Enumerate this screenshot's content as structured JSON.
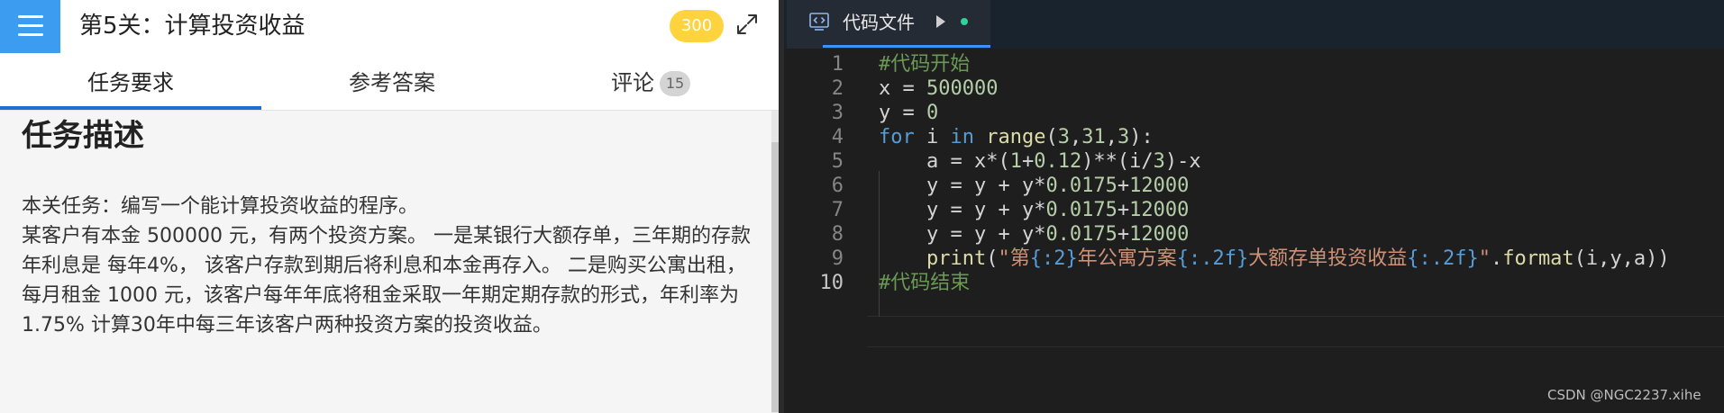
{
  "header": {
    "title": "第5关：计算投资收益",
    "score": "300"
  },
  "tabs": [
    {
      "label": "任务要求"
    },
    {
      "label": "参考答案"
    },
    {
      "label": "评论",
      "badge": "15"
    }
  ],
  "task": {
    "heading": "任务描述",
    "paragraphs": [
      "本关任务：编写一个能计算投资收益的程序。",
      "某客户有本金 500000 元，有两个投资方案。 一是某银行大额存单，三年期的存款年利息是 每年4%， 该客户存款到期后将利息和本金再存入。 二是购买公寓出租，每月租金 1000 元，该客户每年年底将租金采取一年期定期存款的形式，年利率为 1.75% 计算30年中每三年该客户两种投资方案的投资收益。"
    ]
  },
  "editor": {
    "tab_label": "代码文件",
    "lines": [
      {
        "n": "1",
        "indent": "",
        "tokens": [
          [
            "cm",
            "#代码开始"
          ]
        ]
      },
      {
        "n": "2",
        "indent": "",
        "tokens": [
          [
            "id",
            "x = "
          ],
          [
            "num",
            "500000"
          ]
        ]
      },
      {
        "n": "3",
        "indent": "",
        "tokens": [
          [
            "id",
            "y = "
          ],
          [
            "num",
            "0"
          ]
        ]
      },
      {
        "n": "4",
        "indent": "",
        "tokens": [
          [
            "kw",
            "for"
          ],
          [
            "id",
            " i "
          ],
          [
            "kw",
            "in"
          ],
          [
            "id",
            " "
          ],
          [
            "fn",
            "range"
          ],
          [
            "id",
            "("
          ],
          [
            "num",
            "3"
          ],
          [
            "id",
            ","
          ],
          [
            "num",
            "31"
          ],
          [
            "id",
            ","
          ],
          [
            "num",
            "3"
          ],
          [
            "id",
            "):"
          ]
        ]
      },
      {
        "n": "5",
        "indent": "    ",
        "tokens": [
          [
            "id",
            "a = x*("
          ],
          [
            "num",
            "1"
          ],
          [
            "id",
            "+"
          ],
          [
            "num",
            "0.12"
          ],
          [
            "id",
            ")**(i/"
          ],
          [
            "num",
            "3"
          ],
          [
            "id",
            ")-x"
          ]
        ]
      },
      {
        "n": "6",
        "indent": "    ",
        "tokens": [
          [
            "id",
            "y = y + y*"
          ],
          [
            "num",
            "0.0175"
          ],
          [
            "id",
            "+"
          ],
          [
            "num",
            "12000"
          ]
        ]
      },
      {
        "n": "7",
        "indent": "    ",
        "tokens": [
          [
            "id",
            "y = y + y*"
          ],
          [
            "num",
            "0.0175"
          ],
          [
            "id",
            "+"
          ],
          [
            "num",
            "12000"
          ]
        ]
      },
      {
        "n": "8",
        "indent": "    ",
        "tokens": [
          [
            "id",
            "y = y + y*"
          ],
          [
            "num",
            "0.0175"
          ],
          [
            "id",
            "+"
          ],
          [
            "num",
            "12000"
          ]
        ]
      },
      {
        "n": "9",
        "indent": "    ",
        "tokens": [
          [
            "fn",
            "print"
          ],
          [
            "id",
            "("
          ],
          [
            "str",
            "\"第"
          ],
          [
            "ph",
            "{:2}"
          ],
          [
            "str",
            "年公寓方案"
          ],
          [
            "ph",
            "{:.2f}"
          ],
          [
            "str",
            "大额存单投资收益"
          ],
          [
            "ph",
            "{:.2f}"
          ],
          [
            "str",
            "\""
          ],
          [
            "id",
            "."
          ],
          [
            "fn",
            "format"
          ],
          [
            "id",
            "(i,y,a))"
          ]
        ]
      },
      {
        "n": "10",
        "indent": "",
        "tokens": [
          [
            "cm",
            "#代码结束"
          ]
        ]
      }
    ]
  },
  "watermark": "CSDN @NGC2237.xihe"
}
